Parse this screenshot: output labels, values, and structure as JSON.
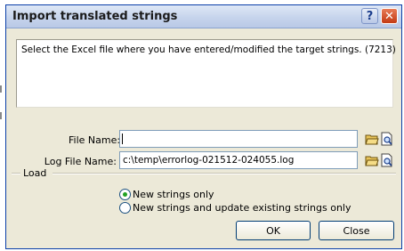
{
  "dialog": {
    "title": "Import translated strings",
    "help_glyph": "?",
    "close_glyph": "✕"
  },
  "description": "Select the Excel file where you have entered/modified the target strings. (7213)",
  "file_name": {
    "label": "File Name:",
    "value": ""
  },
  "log_file_name": {
    "label": "Log File Name:",
    "value": "c:\\temp\\errorlog-021512-024055.log"
  },
  "load": {
    "label": "Load",
    "options": [
      {
        "label": "New strings only",
        "selected": true
      },
      {
        "label": "New strings and update existing strings only",
        "selected": false
      }
    ]
  },
  "buttons": {
    "ok": "OK",
    "close": "Close"
  },
  "colors": {
    "title_bar": "#c6d4ec",
    "dialog_bg": "#ece9d8",
    "close_button": "#c33a13",
    "radio_dot": "#21a121"
  },
  "icons": [
    "help-icon",
    "close-icon",
    "open-folder-icon",
    "preview-icon"
  ]
}
